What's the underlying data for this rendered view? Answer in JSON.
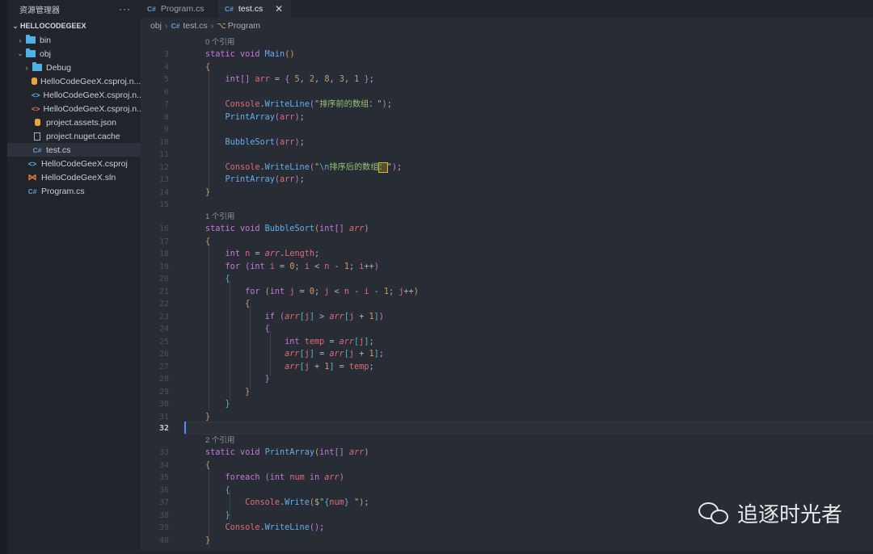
{
  "sidebar": {
    "title": "资源管理器",
    "more": "···",
    "root": "HELLOCODEGEEX",
    "items": [
      {
        "label": "bin",
        "icon": "folder-icon",
        "chev": "›"
      },
      {
        "label": "obj",
        "icon": "folder-icon",
        "chev": "⌄"
      },
      {
        "label": "Debug",
        "icon": "folder-icon",
        "chev": "›"
      },
      {
        "label": "HelloCodeGeeX.csproj.n...",
        "icon": "database-icon"
      },
      {
        "label": "HelloCodeGeeX.csproj.n...",
        "icon": "xml-blue-icon"
      },
      {
        "label": "HelloCodeGeeX.csproj.n...",
        "icon": "xml-red-icon"
      },
      {
        "label": "project.assets.json",
        "icon": "database-icon"
      },
      {
        "label": "project.nuget.cache",
        "icon": "file-icon"
      },
      {
        "label": "test.cs",
        "icon": "csharp-icon"
      },
      {
        "label": "HelloCodeGeeX.csproj",
        "icon": "xml-blue-icon"
      },
      {
        "label": "HelloCodeGeeX.sln",
        "icon": "visualstudio-icon"
      },
      {
        "label": "Program.cs",
        "icon": "csharp-icon"
      }
    ]
  },
  "tabs": [
    {
      "label": "Program.cs",
      "icon": "C#"
    },
    {
      "label": "test.cs",
      "icon": "C#",
      "close": "✕"
    }
  ],
  "breadcrumb": {
    "folder": "obj",
    "sep": "›",
    "icon": "C#",
    "file": "test.cs",
    "symbol": "Program"
  },
  "editor": {
    "current_line": "32",
    "codelens": [
      "0 个引用",
      "1 个引用",
      "2 个引用"
    ],
    "line_numbers": [
      "3",
      "4",
      "5",
      "6",
      "7",
      "8",
      "9",
      "10",
      "11",
      "12",
      "13",
      "14",
      "15",
      "16",
      "17",
      "18",
      "19",
      "20",
      "21",
      "22",
      "23",
      "24",
      "25",
      "26",
      "27",
      "28",
      "29",
      "30",
      "31",
      "32",
      "33",
      "34",
      "35",
      "36",
      "37",
      "38",
      "39",
      "40"
    ]
  },
  "watermark": {
    "text": "追逐时光者"
  },
  "colors": {
    "keyword": "#c678dd",
    "function": "#61afef",
    "number": "#d19a66",
    "string": "#98c379",
    "param": "#e06c75",
    "background": "#282c34"
  }
}
